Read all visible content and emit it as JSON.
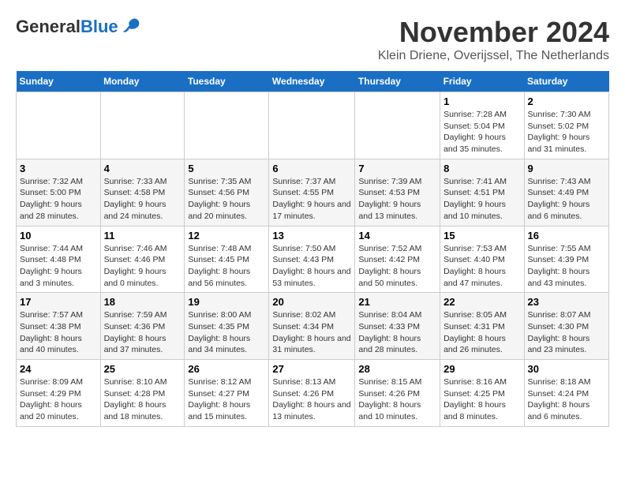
{
  "logo": {
    "general": "General",
    "blue": "Blue"
  },
  "title": "November 2024",
  "subtitle": "Klein Driene, Overijssel, The Netherlands",
  "weekdays": [
    "Sunday",
    "Monday",
    "Tuesday",
    "Wednesday",
    "Thursday",
    "Friday",
    "Saturday"
  ],
  "weeks": [
    [
      {
        "day": "",
        "info": ""
      },
      {
        "day": "",
        "info": ""
      },
      {
        "day": "",
        "info": ""
      },
      {
        "day": "",
        "info": ""
      },
      {
        "day": "",
        "info": ""
      },
      {
        "day": "1",
        "info": "Sunrise: 7:28 AM\nSunset: 5:04 PM\nDaylight: 9 hours and 35 minutes."
      },
      {
        "day": "2",
        "info": "Sunrise: 7:30 AM\nSunset: 5:02 PM\nDaylight: 9 hours and 31 minutes."
      }
    ],
    [
      {
        "day": "3",
        "info": "Sunrise: 7:32 AM\nSunset: 5:00 PM\nDaylight: 9 hours and 28 minutes."
      },
      {
        "day": "4",
        "info": "Sunrise: 7:33 AM\nSunset: 4:58 PM\nDaylight: 9 hours and 24 minutes."
      },
      {
        "day": "5",
        "info": "Sunrise: 7:35 AM\nSunset: 4:56 PM\nDaylight: 9 hours and 20 minutes."
      },
      {
        "day": "6",
        "info": "Sunrise: 7:37 AM\nSunset: 4:55 PM\nDaylight: 9 hours and 17 minutes."
      },
      {
        "day": "7",
        "info": "Sunrise: 7:39 AM\nSunset: 4:53 PM\nDaylight: 9 hours and 13 minutes."
      },
      {
        "day": "8",
        "info": "Sunrise: 7:41 AM\nSunset: 4:51 PM\nDaylight: 9 hours and 10 minutes."
      },
      {
        "day": "9",
        "info": "Sunrise: 7:43 AM\nSunset: 4:49 PM\nDaylight: 9 hours and 6 minutes."
      }
    ],
    [
      {
        "day": "10",
        "info": "Sunrise: 7:44 AM\nSunset: 4:48 PM\nDaylight: 9 hours and 3 minutes."
      },
      {
        "day": "11",
        "info": "Sunrise: 7:46 AM\nSunset: 4:46 PM\nDaylight: 9 hours and 0 minutes."
      },
      {
        "day": "12",
        "info": "Sunrise: 7:48 AM\nSunset: 4:45 PM\nDaylight: 8 hours and 56 minutes."
      },
      {
        "day": "13",
        "info": "Sunrise: 7:50 AM\nSunset: 4:43 PM\nDaylight: 8 hours and 53 minutes."
      },
      {
        "day": "14",
        "info": "Sunrise: 7:52 AM\nSunset: 4:42 PM\nDaylight: 8 hours and 50 minutes."
      },
      {
        "day": "15",
        "info": "Sunrise: 7:53 AM\nSunset: 4:40 PM\nDaylight: 8 hours and 47 minutes."
      },
      {
        "day": "16",
        "info": "Sunrise: 7:55 AM\nSunset: 4:39 PM\nDaylight: 8 hours and 43 minutes."
      }
    ],
    [
      {
        "day": "17",
        "info": "Sunrise: 7:57 AM\nSunset: 4:38 PM\nDaylight: 8 hours and 40 minutes."
      },
      {
        "day": "18",
        "info": "Sunrise: 7:59 AM\nSunset: 4:36 PM\nDaylight: 8 hours and 37 minutes."
      },
      {
        "day": "19",
        "info": "Sunrise: 8:00 AM\nSunset: 4:35 PM\nDaylight: 8 hours and 34 minutes."
      },
      {
        "day": "20",
        "info": "Sunrise: 8:02 AM\nSunset: 4:34 PM\nDaylight: 8 hours and 31 minutes."
      },
      {
        "day": "21",
        "info": "Sunrise: 8:04 AM\nSunset: 4:33 PM\nDaylight: 8 hours and 28 minutes."
      },
      {
        "day": "22",
        "info": "Sunrise: 8:05 AM\nSunset: 4:31 PM\nDaylight: 8 hours and 26 minutes."
      },
      {
        "day": "23",
        "info": "Sunrise: 8:07 AM\nSunset: 4:30 PM\nDaylight: 8 hours and 23 minutes."
      }
    ],
    [
      {
        "day": "24",
        "info": "Sunrise: 8:09 AM\nSunset: 4:29 PM\nDaylight: 8 hours and 20 minutes."
      },
      {
        "day": "25",
        "info": "Sunrise: 8:10 AM\nSunset: 4:28 PM\nDaylight: 8 hours and 18 minutes."
      },
      {
        "day": "26",
        "info": "Sunrise: 8:12 AM\nSunset: 4:27 PM\nDaylight: 8 hours and 15 minutes."
      },
      {
        "day": "27",
        "info": "Sunrise: 8:13 AM\nSunset: 4:26 PM\nDaylight: 8 hours and 13 minutes."
      },
      {
        "day": "28",
        "info": "Sunrise: 8:15 AM\nSunset: 4:26 PM\nDaylight: 8 hours and 10 minutes."
      },
      {
        "day": "29",
        "info": "Sunrise: 8:16 AM\nSunset: 4:25 PM\nDaylight: 8 hours and 8 minutes."
      },
      {
        "day": "30",
        "info": "Sunrise: 8:18 AM\nSunset: 4:24 PM\nDaylight: 8 hours and 6 minutes."
      }
    ]
  ]
}
